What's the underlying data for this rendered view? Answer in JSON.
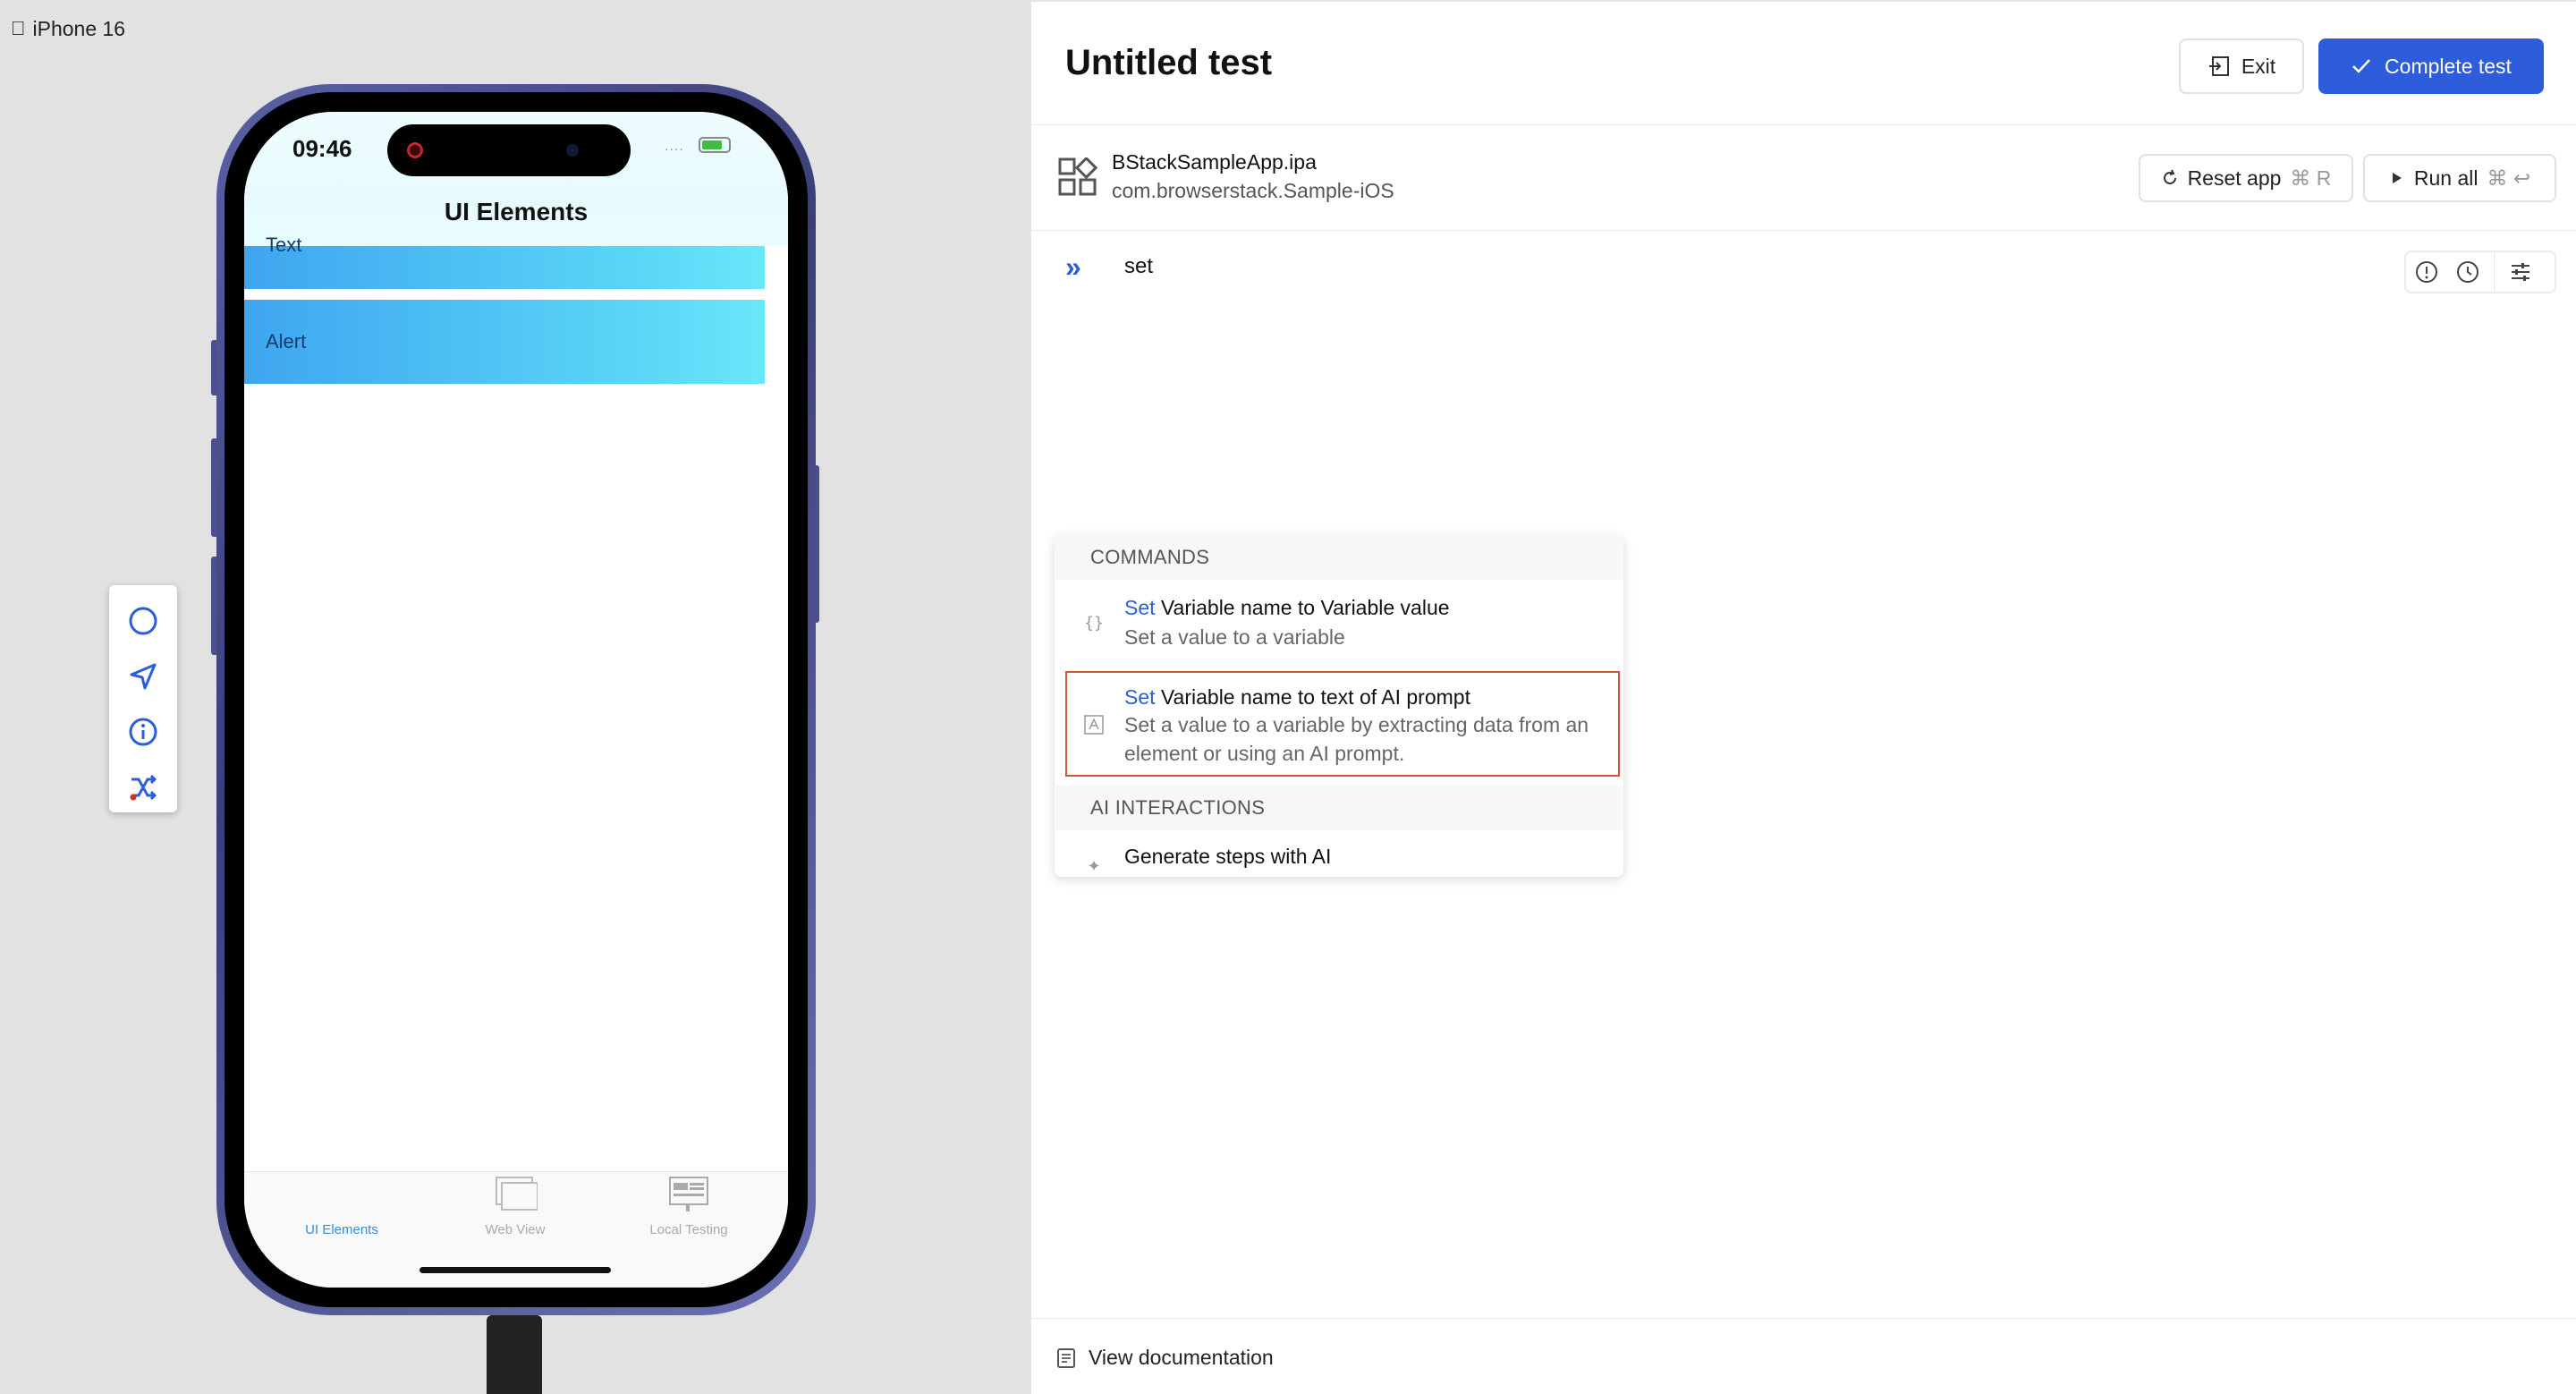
{
  "device": {
    "label": "iPhone 16",
    "status_time": "09:46",
    "signal": "....",
    "nav_title": "UI Elements",
    "cells": [
      "Text",
      "Alert"
    ],
    "tabs": [
      {
        "label": "UI Elements",
        "icon": "ui-elements-tab-icon",
        "active": true
      },
      {
        "label": "Web View",
        "icon": "web-view-tab-icon",
        "active": false
      },
      {
        "label": "Local Testing",
        "icon": "local-testing-tab-icon",
        "active": false
      }
    ],
    "tools": [
      "circle-icon",
      "send-icon",
      "info-icon",
      "shuffle-icon"
    ]
  },
  "editor": {
    "title": "Untitled test",
    "exit_label": "Exit",
    "complete_label": "Complete test",
    "app": {
      "name": "BStackSampleApp.ipa",
      "bundle": "com.browserstack.Sample-iOS"
    },
    "reset_label": "Reset app",
    "reset_shortcut": "⌘ R",
    "run_label": "Run all",
    "run_shortcut": "⌘ ↩",
    "step_input": "set",
    "dropdown": {
      "section_commands": "COMMANDS",
      "cmd1": {
        "kw": "Set",
        "title": "Variable name to Variable value",
        "desc": "Set a value to a variable"
      },
      "cmd2": {
        "kw": "Set",
        "title": "Variable name to text of AI prompt",
        "desc": "Set a value to a variable by extracting data from an element or using an AI prompt."
      },
      "section_ai": "AI INTERACTIONS",
      "cmd3": {
        "title": "Generate steps with AI"
      }
    },
    "footer_link": "View documentation"
  },
  "colors": {
    "accent": "#2d5ddb",
    "highlight_border": "#d2553a",
    "device_bg": "#e2e2e2"
  }
}
